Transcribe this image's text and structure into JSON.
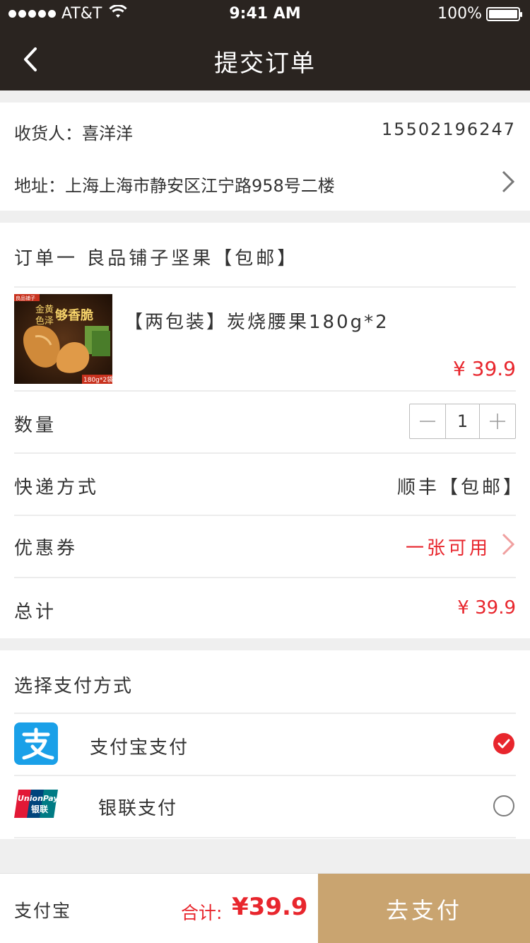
{
  "status": {
    "carrier": "AT&T",
    "time": "9:41 AM",
    "battery": "100%",
    "signal_icon": "signal-dots-icon",
    "wifi_icon": "wifi-icon"
  },
  "nav": {
    "title": "提交订单",
    "back_icon": "back-chevron-icon"
  },
  "address": {
    "receiver_label": "收货人：",
    "receiver_name": "喜洋洋",
    "phone": "15502196247",
    "address_label": "地址：",
    "address": "上海上海市静安区江宁路958号二楼"
  },
  "order": {
    "header": "订单一 良品铺子坚果【包邮】",
    "product": {
      "name": "【两包装】炭烧腰果180g*2",
      "price": "¥ 39.9",
      "image_text": {
        "brand": "良品铺子",
        "line1": "金黄",
        "line2": "色泽",
        "slogan": "够香脆",
        "size": "180g*2袋"
      }
    },
    "quantity_label": "数量",
    "quantity": "1",
    "shipping_label": "快递方式",
    "shipping_value": "顺丰【包邮】",
    "coupon_label": "优惠券",
    "coupon_value": "一张可用",
    "total_label": "总计",
    "total_value": "¥ 39.9"
  },
  "payment": {
    "header": "选择支付方式",
    "options": [
      {
        "label": "支付宝支付",
        "icon": "alipay-icon",
        "selected": true
      },
      {
        "label": "银联支付",
        "icon": "unionpay-icon",
        "selected": false
      }
    ]
  },
  "footer": {
    "method": "支付宝",
    "total_label": "合计:",
    "total_amount": "¥39.9",
    "pay_button": "去支付"
  },
  "colors": {
    "header_bg": "#2a2420",
    "accent_red": "#e8262d",
    "pay_button_bg": "#c9a470",
    "alipay_blue": "#1aa0e8"
  }
}
